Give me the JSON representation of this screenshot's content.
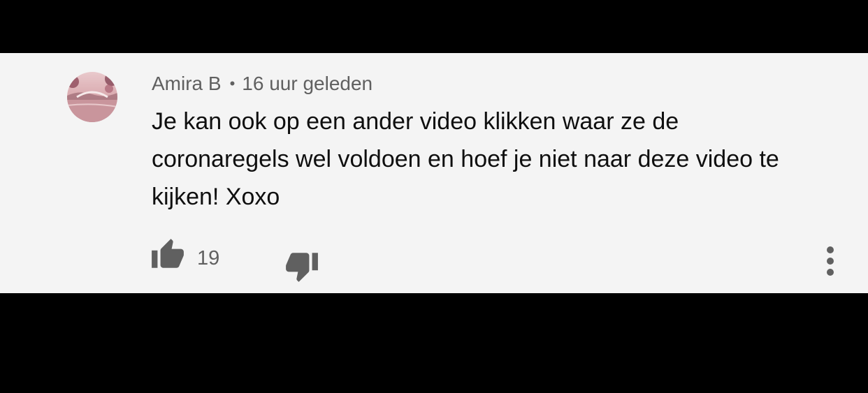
{
  "comment": {
    "author": "Amira B",
    "separator": "•",
    "timestamp": "16 uur geleden",
    "lines": [
      "Je kan ook op een ander video klikken waar ze de",
      "coronaregels wel voldoen en hoef je niet naar deze video te",
      "kijken! Xoxo"
    ],
    "like_count": "19"
  },
  "icons": {
    "avatar": "avatar-image",
    "like": "thumbs-up-icon",
    "dislike": "thumbs-down-icon",
    "more": "vertical-ellipsis-icon"
  },
  "colors": {
    "background": "#000000",
    "card": "#f4f4f4",
    "meta_text": "#606060",
    "body_text": "#0f0f0f",
    "icon": "#606060"
  }
}
